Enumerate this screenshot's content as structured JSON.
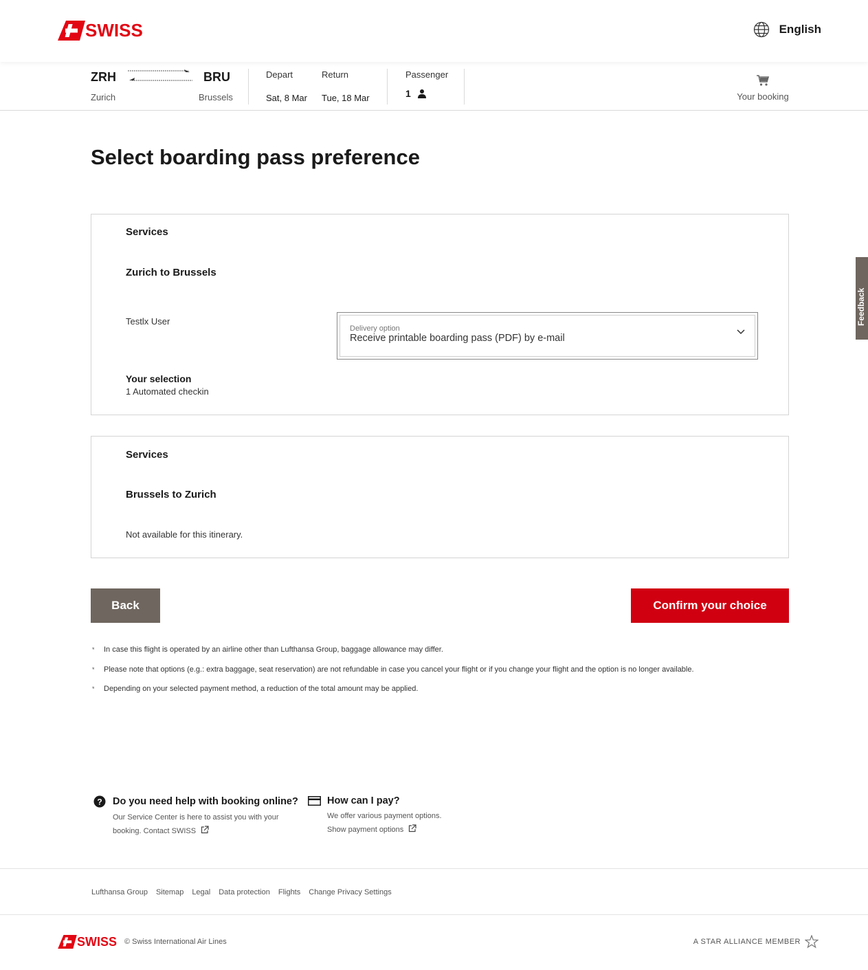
{
  "header": {
    "logo_text": "SWISS",
    "language": "English"
  },
  "summary": {
    "origin_code": "ZRH",
    "origin_city": "Zurich",
    "destination_code": "BRU",
    "destination_city": "Brussels",
    "depart_label": "Depart",
    "depart_date": "Sat, 8 Mar",
    "return_label": "Return",
    "return_date": "Tue, 18 Mar",
    "passenger_label": "Passenger",
    "passenger_count": "1",
    "cart_label": "Your booking"
  },
  "page_title": "Select boarding pass preference",
  "outbound": {
    "services_label": "Services",
    "route": "Zurich to Brussels",
    "passenger_name": "Testlx User",
    "select_label": "Delivery option",
    "select_value": "Receive printable boarding pass (PDF) by e-mail",
    "selection_title": "Your selection",
    "selection_value": "1 Automated checkin"
  },
  "inbound": {
    "services_label": "Services",
    "route": "Brussels to Zurich",
    "message": "Not available for this itinerary."
  },
  "buttons": {
    "back": "Back",
    "confirm": "Confirm your choice"
  },
  "notes": [
    "In case this flight is operated by an airline other than Lufthansa Group, baggage allowance may differ.",
    "Please note that options (e.g.: extra baggage, seat reservation) are not refundable in case you cancel your flight or if you change your flight and the option is no longer available.",
    "Depending on your selected payment method, a reduction of the total amount may be applied."
  ],
  "help": {
    "booking_title": "Do you need help with booking online?",
    "booking_text": "Our Service Center is here to assist you with your",
    "booking_text2": "booking.",
    "booking_link": "Contact SWISS",
    "pay_title": "How can I pay?",
    "pay_text": "We offer various payment options.",
    "pay_link": "Show payment options"
  },
  "footer_links": [
    "Lufthansa Group",
    "Sitemap",
    "Legal",
    "Data protection",
    "Flights",
    "Change Privacy Settings"
  ],
  "bottom": {
    "logo_text": "SWISS",
    "copyright": "©  Swiss International Air Lines",
    "alliance": "A STAR ALLIANCE MEMBER"
  },
  "feedback_label": "Feedback",
  "colors": {
    "brand_red": "#d00011",
    "logo_red": "#e20613",
    "back_button": "#6f665f"
  }
}
